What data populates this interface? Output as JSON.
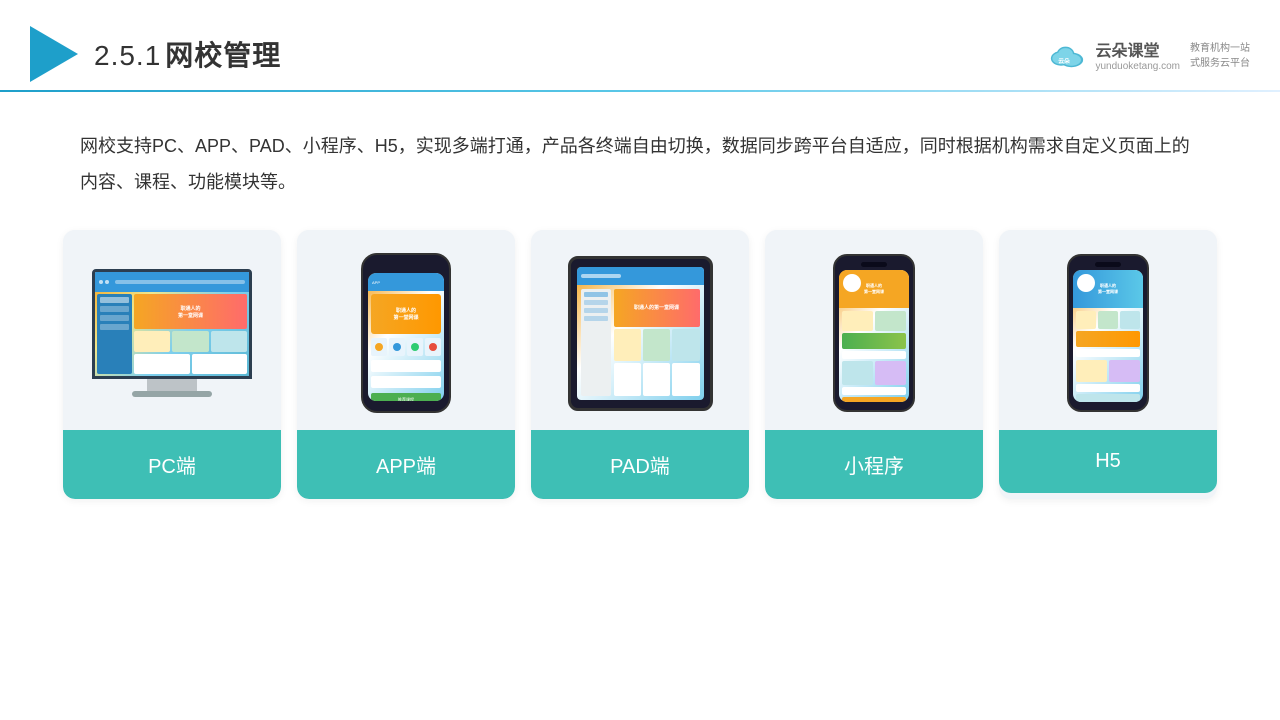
{
  "header": {
    "title_number": "2.5.1",
    "title_text": "网校管理",
    "brand": {
      "name": "云朵课堂",
      "url": "yunduoketang.com",
      "slogan_line1": "教育机构一站",
      "slogan_line2": "式服务云平台"
    }
  },
  "description": "网校支持PC、APP、PAD、小程序、H5，实现多端打通，产品各终端自由切换，数据同步跨平台自适应，同时根据机构需求自定义页面上的内容、课程、功能模块等。",
  "cards": [
    {
      "id": "pc",
      "label": "PC端"
    },
    {
      "id": "app",
      "label": "APP端"
    },
    {
      "id": "pad",
      "label": "PAD端"
    },
    {
      "id": "miniprogram",
      "label": "小程序"
    },
    {
      "id": "h5",
      "label": "H5"
    }
  ],
  "colors": {
    "teal": "#3ebfb5",
    "blue": "#1e9fca",
    "accent": "#f5a623"
  }
}
